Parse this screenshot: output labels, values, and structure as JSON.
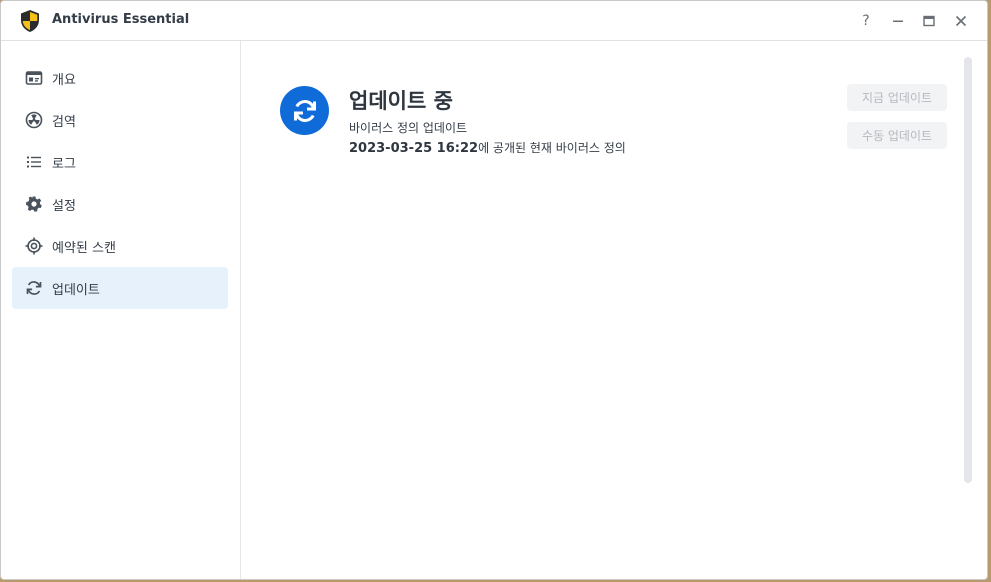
{
  "window": {
    "title": "Antivirus Essential",
    "controls": [
      "?",
      "–",
      "▭",
      "✕"
    ]
  },
  "sidebar": {
    "items": [
      {
        "label": "개요",
        "icon": "overview-card-icon",
        "active": false
      },
      {
        "label": "검역",
        "icon": "radiation-icon",
        "active": false
      },
      {
        "label": "로그",
        "icon": "list-icon",
        "active": false
      },
      {
        "label": "설정",
        "icon": "gear-icon",
        "active": false
      },
      {
        "label": "예약된 스캔",
        "icon": "target-icon",
        "active": false
      },
      {
        "label": "업데이트",
        "icon": "refresh-icon",
        "active": true
      }
    ]
  },
  "main": {
    "status_title": "업데이트 중",
    "status_subtitle": "바이러스 정의 업데이트",
    "definition_date": "2023-03-25 16:22",
    "definition_suffix": "에 공개된 현재 바이러스 정의",
    "buttons": {
      "update_now": "지금 업데이트",
      "manual_update": "수동 업데이트"
    }
  },
  "colors": {
    "accent": "#0f6bd8",
    "active_nav_bg": "#e6f1fc",
    "text": "#333c47",
    "disabled_text": "#b4b9bf"
  }
}
